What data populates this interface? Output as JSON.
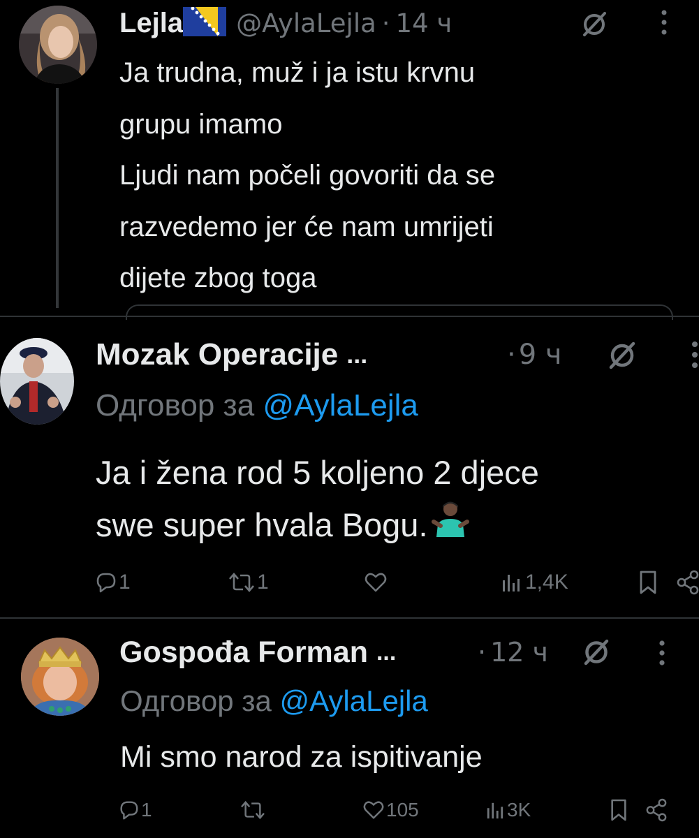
{
  "tweets": [
    {
      "display_name": "Lejla",
      "flag_icon": "bosnia-flag-icon",
      "handle": "@AylaLejla",
      "separator": "·",
      "time": "14 ч",
      "lines": [
        "Ja trudna, muž i ja istu krvnu",
        "grupu imamo",
        "Ljudi nam počeli govoriti da se",
        "razvedemo jer će nam umrijeti",
        "dijete zbog toga"
      ]
    },
    {
      "display_name": "Mozak Operacije",
      "ellipsis": "...",
      "separator": "·",
      "time": "9 ч",
      "reply_prefix": "Одговор за",
      "reply_handle": "@AylaLejla",
      "lines": [
        "Ja i žena rod 5 koljeno 2 djece",
        "swe super hvala Bogu."
      ],
      "emoji": "person-shrugging-emoji",
      "actions": {
        "replies": "1",
        "reposts": "1",
        "likes": "",
        "views": "1,4K"
      }
    },
    {
      "display_name": "Gospođa Forman",
      "ellipsis": "...",
      "separator": "·",
      "time": "12 ч",
      "reply_prefix": "Одговор за",
      "reply_handle": "@AylaLejla",
      "lines": [
        "Mi smo narod za ispitivanje"
      ],
      "actions": {
        "replies": "1",
        "reposts": "",
        "likes": "105",
        "views": "3K"
      }
    }
  ],
  "colors": {
    "background": "#000000",
    "text": "#e7e9ea",
    "muted": "#71767b",
    "link": "#1d9bf0",
    "divider": "#2f3336"
  }
}
